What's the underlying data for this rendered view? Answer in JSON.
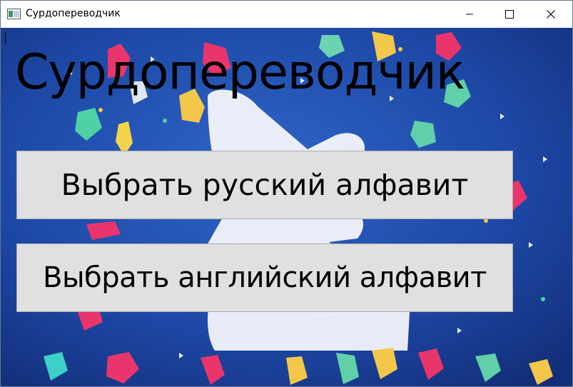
{
  "window": {
    "title": "Сурдопереводчик",
    "controls": {
      "minimize": "minimize-icon",
      "maximize": "maximize-icon",
      "close": "close-icon"
    }
  },
  "main": {
    "heading": "Сурдопереводчик",
    "buttons": {
      "russian_label": "Выбрать русский алфавит",
      "english_label": "Выбрать английский алфавит"
    }
  },
  "colors": {
    "background": "#1f4aa8",
    "button": "#e0e0e0",
    "text": "#000000"
  }
}
